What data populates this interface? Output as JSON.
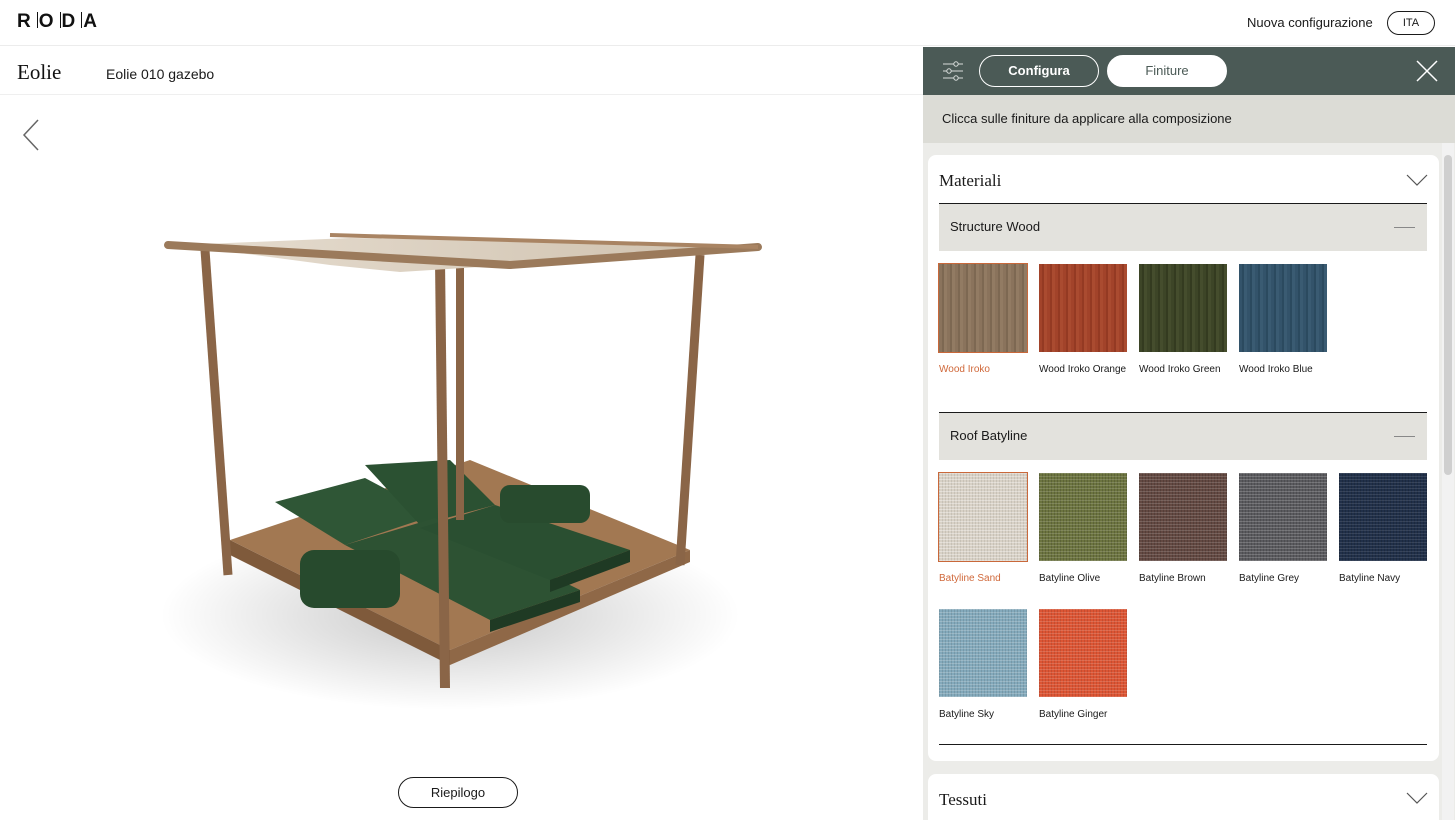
{
  "topbar": {
    "logo": "RODA",
    "new_config": "Nuova configurazione",
    "lang": "ITA"
  },
  "product": {
    "name": "Eolie",
    "variant": "Eolie 010 gazebo",
    "summary_button": "Riepilogo"
  },
  "panel": {
    "tabs": [
      {
        "label": "Configura"
      },
      {
        "label": "Finiture"
      }
    ],
    "active_tab": "Finiture",
    "hint": "Clicca sulle finiture da applicare alla composizione",
    "materials_title": "Materiali",
    "fabrics_title": "Tessuti",
    "groups": [
      {
        "title": "Structure Wood",
        "swatches": [
          {
            "name": "Wood Iroko",
            "color": "#8a735c",
            "selected": true
          },
          {
            "name": "Wood Iroko Orange",
            "color": "#a2432a",
            "selected": false
          },
          {
            "name": "Wood Iroko Green",
            "color": "#3d4527",
            "selected": false
          },
          {
            "name": "Wood Iroko Blue",
            "color": "#33536a",
            "selected": false
          }
        ]
      },
      {
        "title": "Roof Batyline",
        "swatches": [
          {
            "name": "Batyline Sand",
            "color": "#d8d1c6",
            "selected": true
          },
          {
            "name": "Batyline Olive",
            "color": "#6c7440",
            "selected": false
          },
          {
            "name": "Batyline Brown",
            "color": "#634942",
            "selected": false
          },
          {
            "name": "Batyline Grey",
            "color": "#5a5a5e",
            "selected": false
          },
          {
            "name": "Batyline Navy",
            "color": "#213049",
            "selected": false
          },
          {
            "name": "Batyline Sky",
            "color": "#83a9bb",
            "selected": false
          },
          {
            "name": "Batyline Ginger",
            "color": "#dc5534",
            "selected": false
          }
        ]
      }
    ]
  },
  "colors": {
    "panel_header": "#4b5a56",
    "accent": "#d0683a",
    "cushion": "#2d5233"
  }
}
